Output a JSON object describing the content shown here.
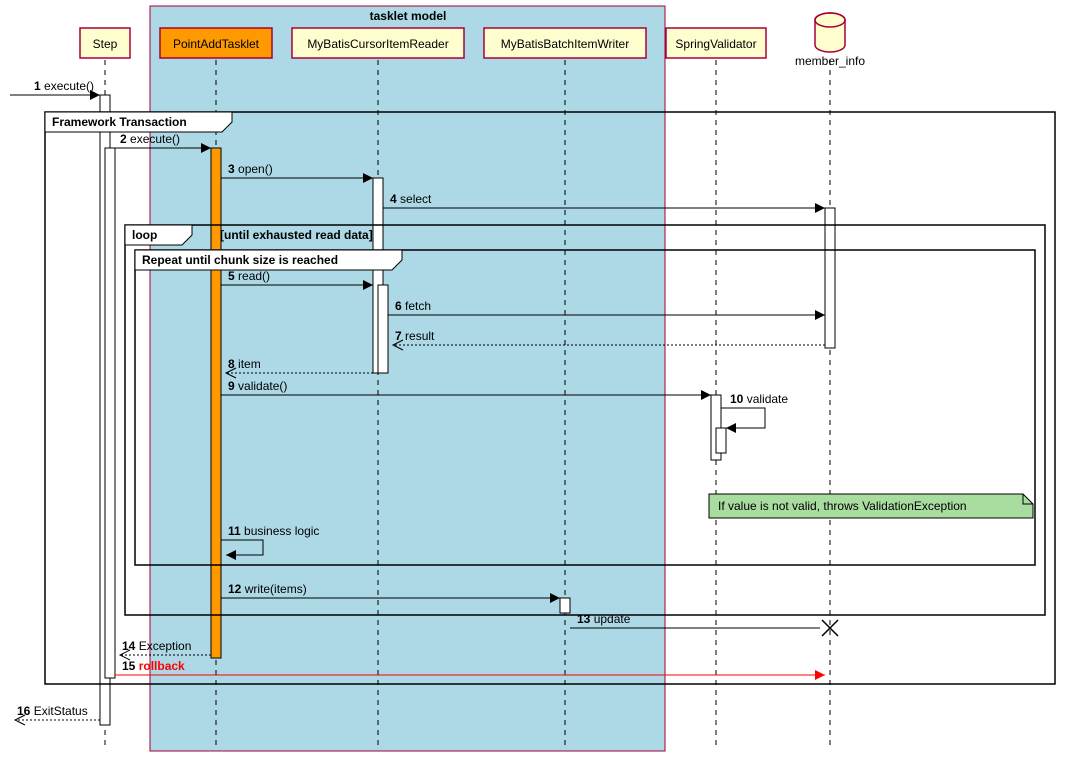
{
  "box_title": "tasklet model",
  "participants": {
    "step": "Step",
    "tasklet": "PointAddTasklet",
    "reader": "MyBatisCursorItemReader",
    "writer": "MyBatisBatchItemWriter",
    "validator": "SpringValidator",
    "db": "member_info"
  },
  "frames": {
    "transaction": "Framework Transaction",
    "loop": "loop",
    "loop_cond": "[until exhausted read data]",
    "repeat": "Repeat until chunk size is reached"
  },
  "messages": {
    "m1_n": "1",
    "m1": "execute()",
    "m2_n": "2",
    "m2": "execute()",
    "m3_n": "3",
    "m3": "open()",
    "m4_n": "4",
    "m4": "select",
    "m5_n": "5",
    "m5": "read()",
    "m6_n": "6",
    "m6": "fetch",
    "m7_n": "7",
    "m7": "result",
    "m8_n": "8",
    "m8": "item",
    "m9_n": "9",
    "m9": "validate()",
    "m10_n": "10",
    "m10": "validate",
    "m11_n": "11",
    "m11": "business logic",
    "m12_n": "12",
    "m12": "write(items)",
    "m13_n": "13",
    "m13": "update",
    "m14_n": "14",
    "m14": "Exception",
    "m15_n": "15",
    "m15": "rollback",
    "m16_n": "16",
    "m16": "ExitStatus"
  },
  "note": "If value is not valid, throws ValidationException"
}
